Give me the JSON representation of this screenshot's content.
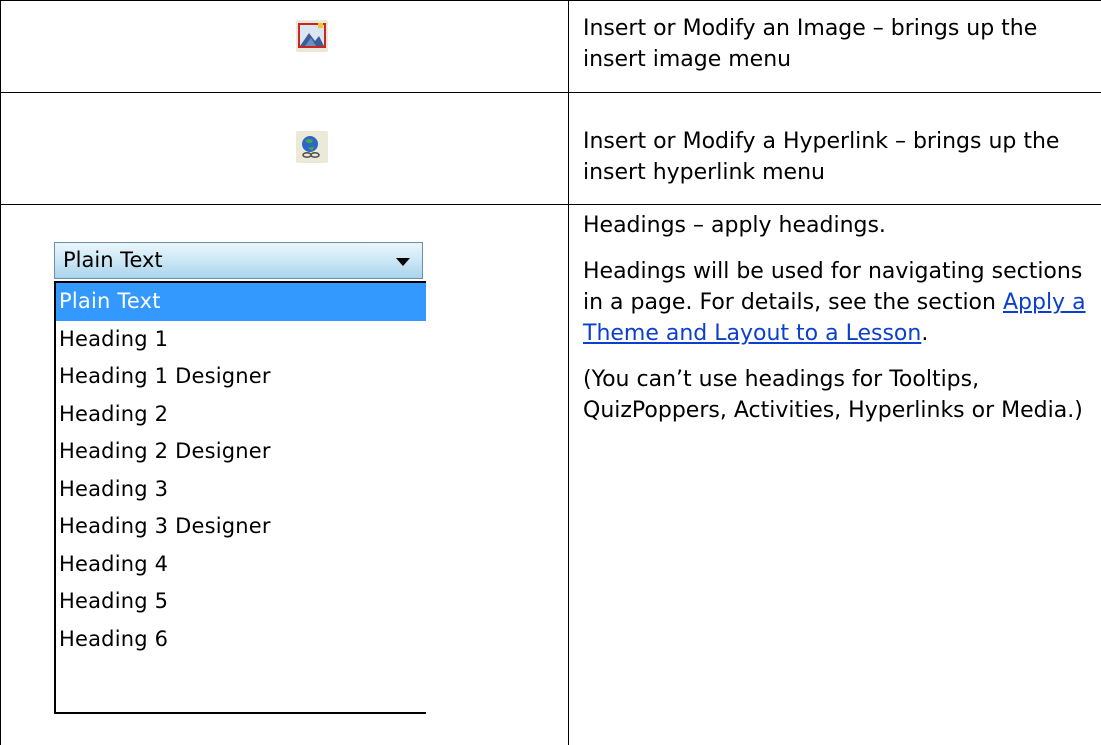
{
  "rows": [
    {
      "icon": "insert-image-icon",
      "description": "Insert or Modify an Image – brings up the insert image menu"
    },
    {
      "icon": "insert-hyperlink-globe-icon",
      "description": "Insert or Modify a Hyperlink – brings up the insert hyperlink menu"
    },
    {
      "icon": "headings-dropdown",
      "heading_summary": "Headings – apply headings.",
      "details_prefix": "Headings will be used for navigating sections in a page. For details, see the section ",
      "details_link": "Apply a Theme and Layout to a Lesson",
      "details_suffix": ".",
      "note": "(You can’t use headings for Tooltips, QuizPoppers, Activities, Hyperlinks or Media.)"
    }
  ],
  "dropdown": {
    "selected_value": "Plain Text",
    "options": [
      "Plain Text",
      "Heading 1",
      "Heading 1 Designer",
      "Heading 2",
      "Heading 2 Designer",
      "Heading 3",
      "Heading 3 Designer",
      "Heading 4",
      "Heading 5",
      "Heading 6"
    ],
    "highlighted_index": 0,
    "highlight_color": "#3399ff"
  },
  "link_color": "#0b3fcf"
}
